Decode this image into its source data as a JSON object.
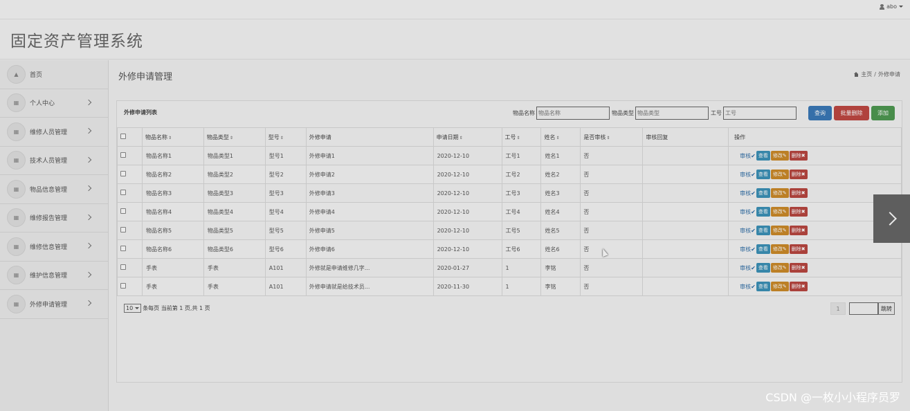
{
  "topbar": {
    "user": "abo"
  },
  "header": {
    "title": "固定资产管理系统"
  },
  "sidebar": {
    "items": [
      {
        "label": "首页",
        "icon": "home-icon"
      },
      {
        "label": "个人中心",
        "icon": "grid-icon"
      },
      {
        "label": "维修人员管理",
        "icon": "grid-icon"
      },
      {
        "label": "技术人员管理",
        "icon": "grid-icon"
      },
      {
        "label": "物品信息管理",
        "icon": "grid-icon"
      },
      {
        "label": "维修报告管理",
        "icon": "grid-icon"
      },
      {
        "label": "维修信息管理",
        "icon": "grid-icon"
      },
      {
        "label": "维护信息管理",
        "icon": "grid-icon"
      },
      {
        "label": "外修申请管理",
        "icon": "grid-icon"
      }
    ]
  },
  "page": {
    "title": "外修申请管理",
    "breadcrumb": {
      "home": "主页",
      "sep": "/",
      "current": "外修申请"
    }
  },
  "panel": {
    "title": "外修申请列表",
    "search": {
      "name_label": "物品名称",
      "name_placeholder": "物品名称",
      "type_label": "物品类型",
      "type_placeholder": "物品类型",
      "no_label": "工号",
      "no_placeholder": "工号"
    },
    "buttons": {
      "query": "查询",
      "batch_delete": "批量删除",
      "add": "添加"
    }
  },
  "table": {
    "headers": [
      "物品名称",
      "物品类型",
      "型号",
      "外修申请",
      "申请日期",
      "工号",
      "姓名",
      "是否审核",
      "审核回复",
      "操作"
    ],
    "sortable": [
      true,
      true,
      true,
      false,
      true,
      true,
      true,
      true,
      false,
      false
    ],
    "ops": {
      "review": "审核",
      "view": "查看",
      "edit": "修改",
      "delete": "删除"
    },
    "rows": [
      [
        "物品名称1",
        "物品类型1",
        "型号1",
        "外修申请1",
        "2020-12-10",
        "工号1",
        "姓名1",
        "否",
        ""
      ],
      [
        "物品名称2",
        "物品类型2",
        "型号2",
        "外修申请2",
        "2020-12-10",
        "工号2",
        "姓名2",
        "否",
        ""
      ],
      [
        "物品名称3",
        "物品类型3",
        "型号3",
        "外修申请3",
        "2020-12-10",
        "工号3",
        "姓名3",
        "否",
        ""
      ],
      [
        "物品名称4",
        "物品类型4",
        "型号4",
        "外修申请4",
        "2020-12-10",
        "工号4",
        "姓名4",
        "否",
        ""
      ],
      [
        "物品名称5",
        "物品类型5",
        "型号5",
        "外修申请5",
        "2020-12-10",
        "工号5",
        "姓名5",
        "否",
        ""
      ],
      [
        "物品名称6",
        "物品类型6",
        "型号6",
        "外修申请6",
        "2020-12-10",
        "工号6",
        "姓名6",
        "否",
        ""
      ],
      [
        "手表",
        "手表",
        "A101",
        "外修就是申请维修几字...",
        "2020-01-27",
        "1",
        "李铭",
        "否",
        ""
      ],
      [
        "手表",
        "手表",
        "A101",
        "外修申请就是给技术员...",
        "2020-11-30",
        "1",
        "李铭",
        "否",
        ""
      ]
    ]
  },
  "pager": {
    "page_size": "10",
    "summary": "条每页 当前第 1 页,共 1 页",
    "current_page": "1",
    "jump_label": "跳转"
  },
  "watermark": "CSDN @一枚小小程序员罗"
}
